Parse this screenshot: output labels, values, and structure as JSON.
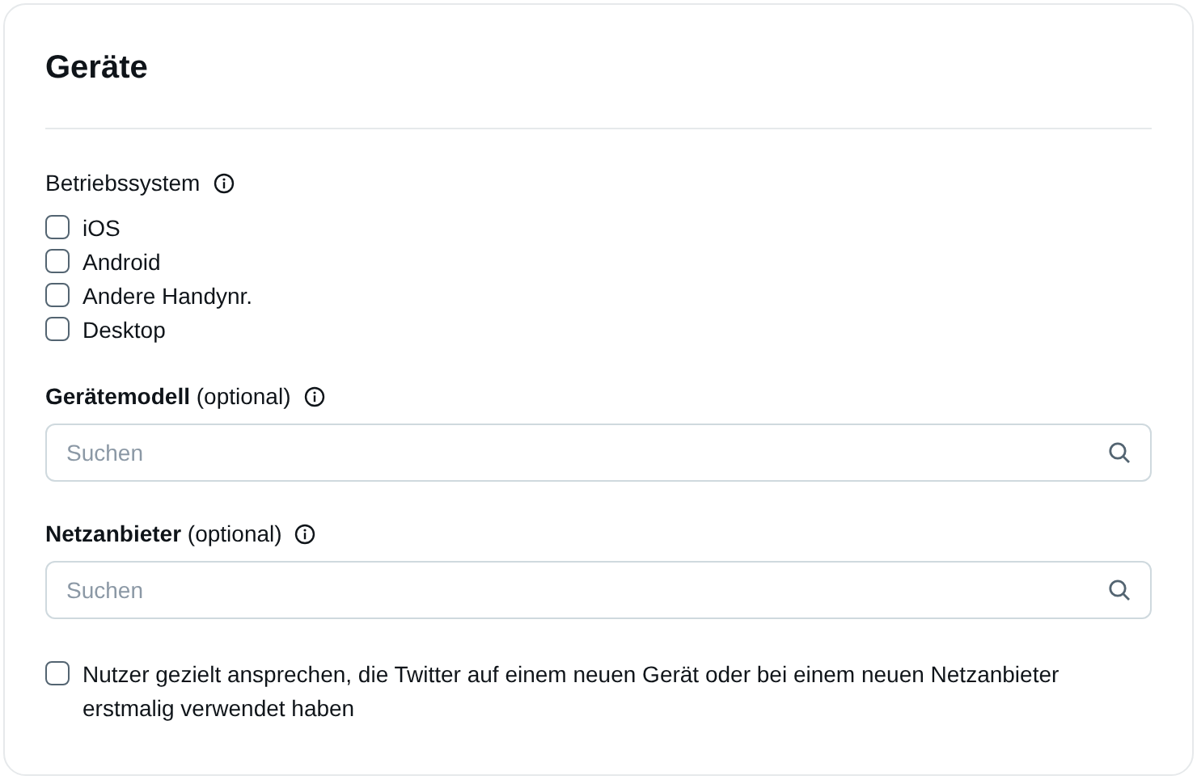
{
  "title": "Geräte",
  "os": {
    "label": "Betriebssystem",
    "options": [
      {
        "label": "iOS",
        "checked": false
      },
      {
        "label": "Android",
        "checked": false
      },
      {
        "label": "Andere Handynr.",
        "checked": false
      },
      {
        "label": "Desktop",
        "checked": false
      }
    ]
  },
  "fields": [
    {
      "label": "**Gerätemodell** (optional)",
      "placeholder": "Suchen"
    },
    {
      "label": "**Netzanbieter** (optional)",
      "placeholder": "Suchen"
    }
  ],
  "new_device": {
    "label": "Nutzer gezielt ansprechen, die Twitter auf einem neuen Gerät oder bei einem neuen Netzanbieter erstmalig verwendet haben",
    "checked": false
  }
}
